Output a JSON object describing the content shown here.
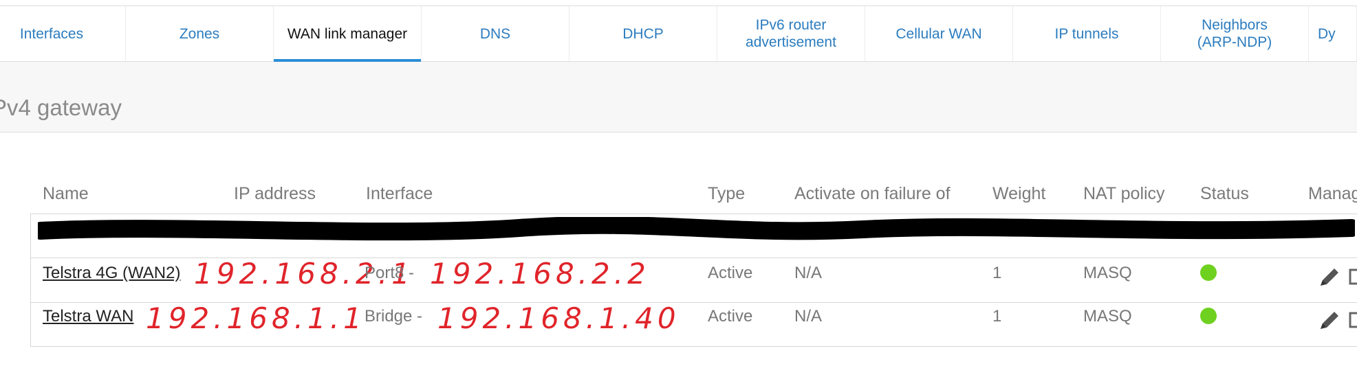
{
  "tabs": [
    {
      "label": "Interfaces"
    },
    {
      "label": "Zones"
    },
    {
      "label": "WAN link manager",
      "active": true
    },
    {
      "label": "DNS"
    },
    {
      "label": "DHCP"
    },
    {
      "label": "IPv6 router advertisement"
    },
    {
      "label": "Cellular WAN"
    },
    {
      "label": "IP tunnels"
    },
    {
      "label": "Neighbors (ARP-NDP)"
    },
    {
      "label": "Dy"
    }
  ],
  "section": {
    "title": "Pv4 gateway"
  },
  "table": {
    "columns": [
      "Name",
      "IP address",
      "Interface",
      "Type",
      "Activate on failure of",
      "Weight",
      "NAT policy",
      "Status",
      "Manag"
    ],
    "rows": [
      {
        "name": "Telstra 4G (WAN2)",
        "ip_handwritten": "192.168.2.1",
        "interface_prefix": "Port8 -",
        "interface_handwritten": "192.168.2.2",
        "type": "Active",
        "failover": "N/A",
        "weight": "1",
        "nat": "MASQ",
        "status_color": "#6fd11f"
      },
      {
        "name": "Telstra WAN",
        "ip_handwritten": "192.168.1.1",
        "interface_prefix": "Bridge -",
        "interface_handwritten": "192.168.1.40",
        "type": "Active",
        "failover": "N/A",
        "weight": "1",
        "nat": "MASQ",
        "status_color": "#6fd11f"
      }
    ]
  },
  "icons": {
    "edit": "pencil-icon",
    "secondary": "edit-box-icon"
  },
  "colors": {
    "tab_link": "#2b7cbf",
    "tab_underline": "#2b8ed6",
    "status_ok": "#6fd11f",
    "handwriting": "#e0242a"
  }
}
